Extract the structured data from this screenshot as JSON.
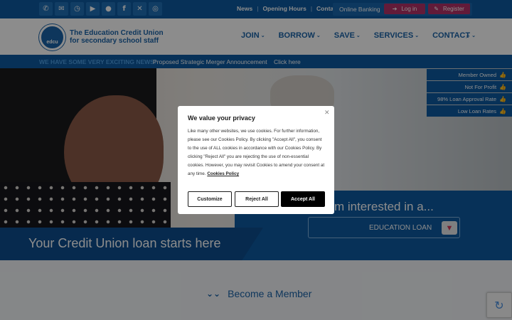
{
  "topbar": {
    "social_icons": [
      "phone-icon",
      "mail-icon",
      "clock-icon",
      "google-play-icon",
      "apple-icon",
      "facebook-icon",
      "x-twitter-icon",
      "instagram-icon"
    ],
    "links": [
      "News",
      "Opening Hours",
      "Contact"
    ],
    "online_banking_label": "Online Banking",
    "login_label": "Log in",
    "register_label": "Register"
  },
  "header": {
    "logo_text": "edcu",
    "org_name_line1": "The Education Credit Union",
    "org_name_line2": "for secondary school staff",
    "nav": [
      "JOIN",
      "BORROW",
      "SAVE",
      "SERVICES",
      "CONTACT"
    ]
  },
  "newsbar": {
    "headline": "WE HAVE SOME VERY EXCITING NEWS!",
    "announcement": "Proposed Strategic Merger Announcement",
    "cta": "Click here"
  },
  "hero": {
    "tagline": "Your Credit Union loan starts here",
    "interested_label": "I'm interested in a...",
    "loan_select_value": "EDUCATION LOAN",
    "badges": [
      "Member Owned",
      "Not For Profit",
      "98% Loan Approval Rate",
      "Low Loan Rates"
    ]
  },
  "become": {
    "label": "Become a Member"
  },
  "cookie_modal": {
    "title": "We value your privacy",
    "body": "Like many other websites, we use cookies. For further information, please see our Cookies Policy. By clicking \"Accept All\", you consent to the use of ALL cookies in accordance with our Cookies Policy. By clicking \"Reject All\" you are rejecting the use of non-essential cookies. However, you may revisit Cookies to amend your consent at any time.",
    "policy_link": "Cookies Policy",
    "customize_label": "Customize",
    "reject_label": "Reject All",
    "accept_label": "Accept All"
  },
  "colors": {
    "brand_blue": "#0d5aa0",
    "accent_pink": "#b23268"
  }
}
